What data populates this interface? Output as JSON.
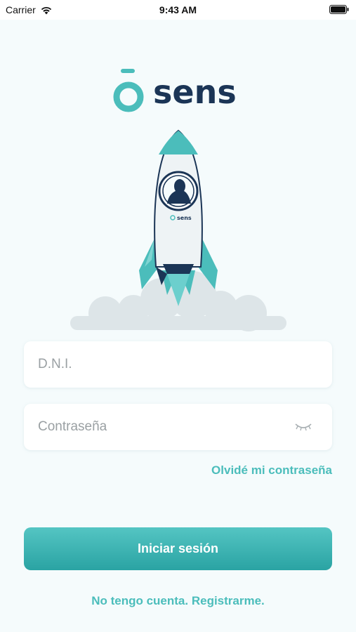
{
  "status_bar": {
    "carrier": "Carrier",
    "time": "9:43 AM"
  },
  "brand": {
    "name": "sens",
    "mini_name": "sens",
    "accent_color": "#4bbdbb",
    "text_color": "#1b3556"
  },
  "form": {
    "dni_placeholder": "D.N.I.",
    "password_placeholder": "Contraseña",
    "forgot_label": "Olvidé mi contraseña",
    "submit_label": "Iniciar sesión",
    "register_label": "No tengo cuenta. Registrarme."
  },
  "icons": {
    "wifi": "wifi-icon",
    "battery": "battery-icon",
    "eye": "eye-closed-icon",
    "logo": "sens-logo-icon",
    "illustration": "rocket-illustration"
  }
}
